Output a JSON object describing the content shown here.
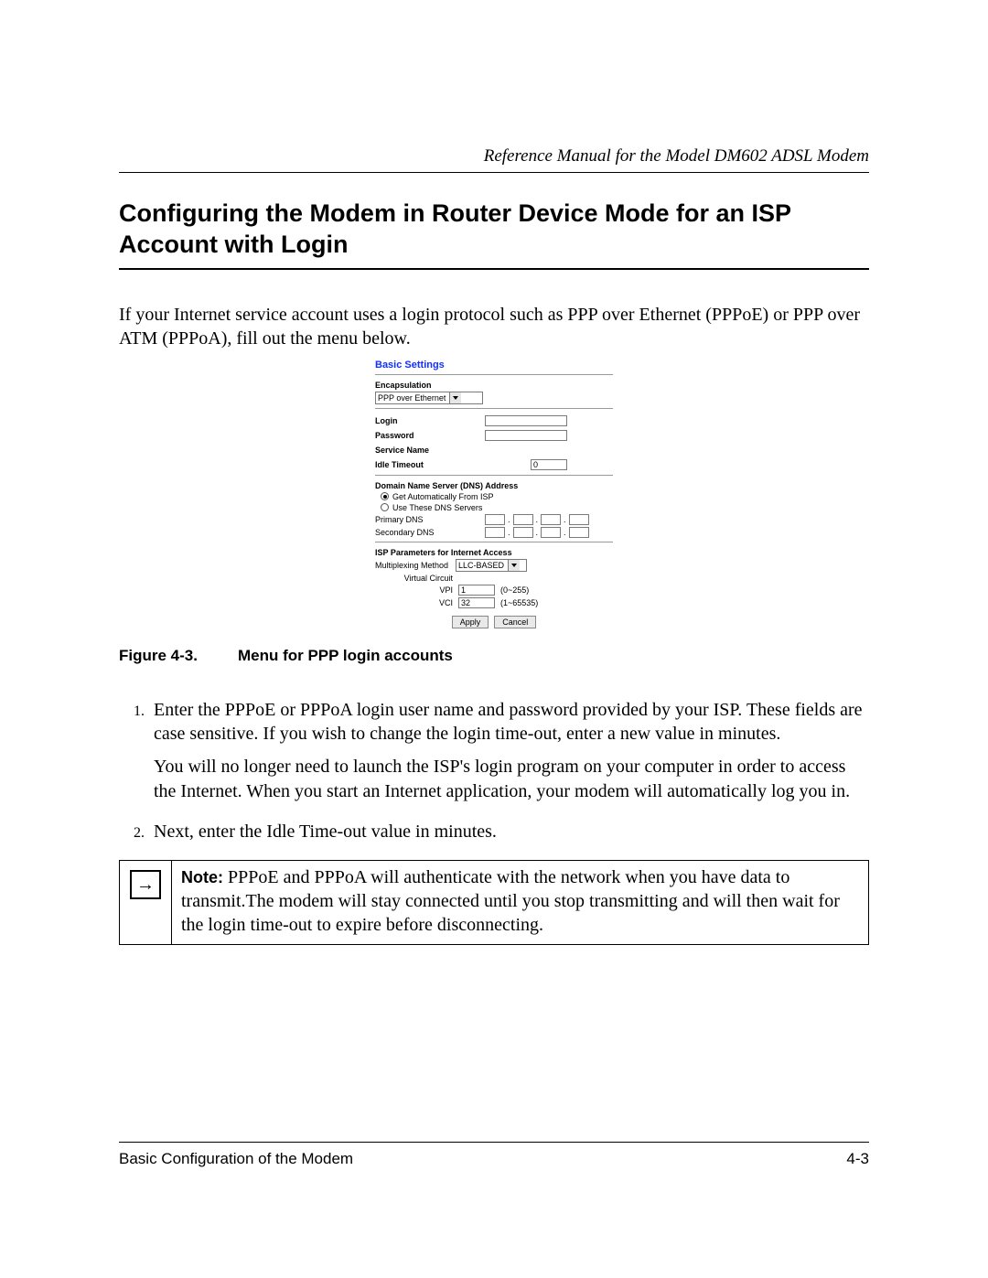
{
  "header": {
    "running_head": "Reference Manual for the Model DM602 ADSL Modem"
  },
  "section_title": "Configuring the Modem in Router Device Mode for an ISP Account with Login",
  "intro": "If your Internet service account uses a login protocol such as PPP over Ethernet (PPPoE) or PPP over ATM (PPPoA), fill out the menu below.",
  "settings": {
    "title": "Basic Settings",
    "encapsulation_label": "Encapsulation",
    "encapsulation_value": "PPP over Ethernet",
    "login_label": "Login",
    "password_label": "Password",
    "service_name_label": "Service Name",
    "idle_timeout_label": "Idle Timeout",
    "idle_timeout_value": "0",
    "dns_heading": "Domain Name Server (DNS) Address",
    "dns_auto_label": "Get Automatically From ISP",
    "dns_use_label": "Use These DNS Servers",
    "primary_dns_label": "Primary DNS",
    "secondary_dns_label": "Secondary DNS",
    "isp_heading": "ISP Parameters for Internet Access",
    "mux_label": "Multiplexing Method",
    "mux_value": "LLC-BASED",
    "vc_label": "Virtual Circuit",
    "vpi_label": "VPI",
    "vpi_value": "1",
    "vpi_hint": "(0~255)",
    "vci_label": "VCI",
    "vci_value": "32",
    "vci_hint": "(1~65535)",
    "apply": "Apply",
    "cancel": "Cancel"
  },
  "figure": {
    "num": "Figure 4-3.",
    "caption": "Menu for PPP login accounts"
  },
  "steps": {
    "s1a": "Enter the PPPoE or PPPoA login user name and password provided by your ISP. These fields are case sensitive. If you wish to change the login time-out, enter a new value in minutes.",
    "s1b": "You will no longer need to launch the ISP's login program on your computer in order to access the Internet. When you start an Internet application, your modem will automatically log you in.",
    "s2": "Next, enter the Idle Time-out value in minutes."
  },
  "note": {
    "label": "Note:",
    "text": " PPPoE and PPPoA will authenticate with the network when you have data to transmit.The modem will stay connected until you stop transmitting and will then wait for the login time-out to expire before disconnecting."
  },
  "footer": {
    "left": "Basic Configuration of the Modem",
    "right": "4-3"
  }
}
